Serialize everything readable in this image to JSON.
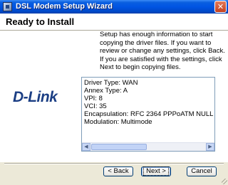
{
  "window": {
    "title": "DSL Modem Setup Wizard",
    "close_glyph": "✕"
  },
  "header": {
    "heading": "Ready to Install"
  },
  "logo": {
    "text": "D-Link"
  },
  "description": "Setup has enough information to start copying the driver files.  If you want to review or change any settings, click Back.  If you are satisfied with the settings, click Next to begin copying files.",
  "summary": {
    "lines": [
      "Driver Type: WAN",
      "Annex Type: A",
      "VPI: 8",
      "VCI: 35",
      "Encapsulation: RFC 2364 PPPoATM NULL",
      "Modulation: Multimode"
    ],
    "scroll_left_glyph": "◀",
    "scroll_right_glyph": "▶"
  },
  "buttons": {
    "back": "< Back",
    "next": "Next >",
    "cancel": "Cancel"
  },
  "icons": [
    "app-icon",
    "close-icon",
    "scroll-left-icon",
    "scroll-right-icon",
    "resize-grip-icon"
  ]
}
